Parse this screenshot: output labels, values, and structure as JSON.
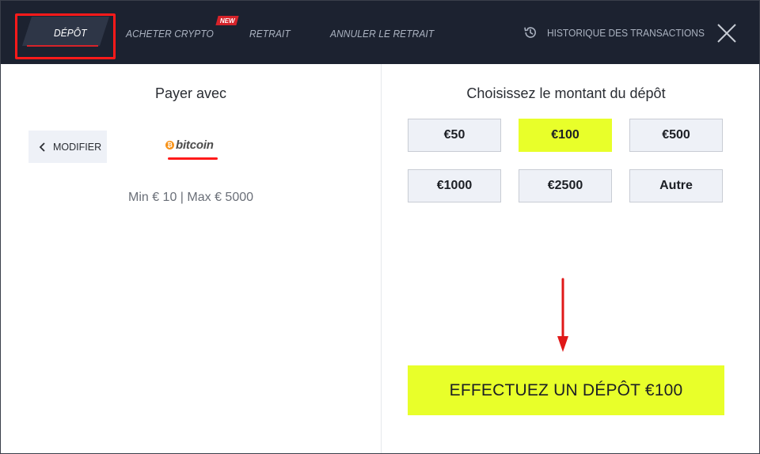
{
  "tabs": {
    "deposit": "DÉPÔT",
    "buy_crypto": "ACHETER CRYPTO",
    "buy_crypto_badge": "NEW",
    "withdraw": "RETRAIT",
    "cancel_withdraw": "ANNULER LE RETRAIT",
    "active": "deposit"
  },
  "history": {
    "label": "HISTORIQUE DES TRANSACTIONS",
    "icon": "history-icon"
  },
  "close": {
    "icon": "close-icon"
  },
  "payment": {
    "title": "Payer avec",
    "modify_label": "MODIFIER",
    "method_logo_text": "bitcoin",
    "method_coin_symbol": "₿",
    "limits": "Min € 10 | Max € 5000"
  },
  "amounts": {
    "title": "Choisissez le montant du dépôt",
    "options": [
      "€50",
      "€100",
      "€500",
      "€1000",
      "€2500",
      "Autre"
    ],
    "selected_index": 1
  },
  "deposit_button": {
    "label": "EFFECTUEZ UN DÉPÔT €100"
  },
  "colors": {
    "header_bg": "#1c2230",
    "accent_red": "#d6232a",
    "highlight_yellow": "#e8ff2a",
    "annotation_red": "#ff1a1a",
    "bitcoin_orange": "#f7931a"
  }
}
